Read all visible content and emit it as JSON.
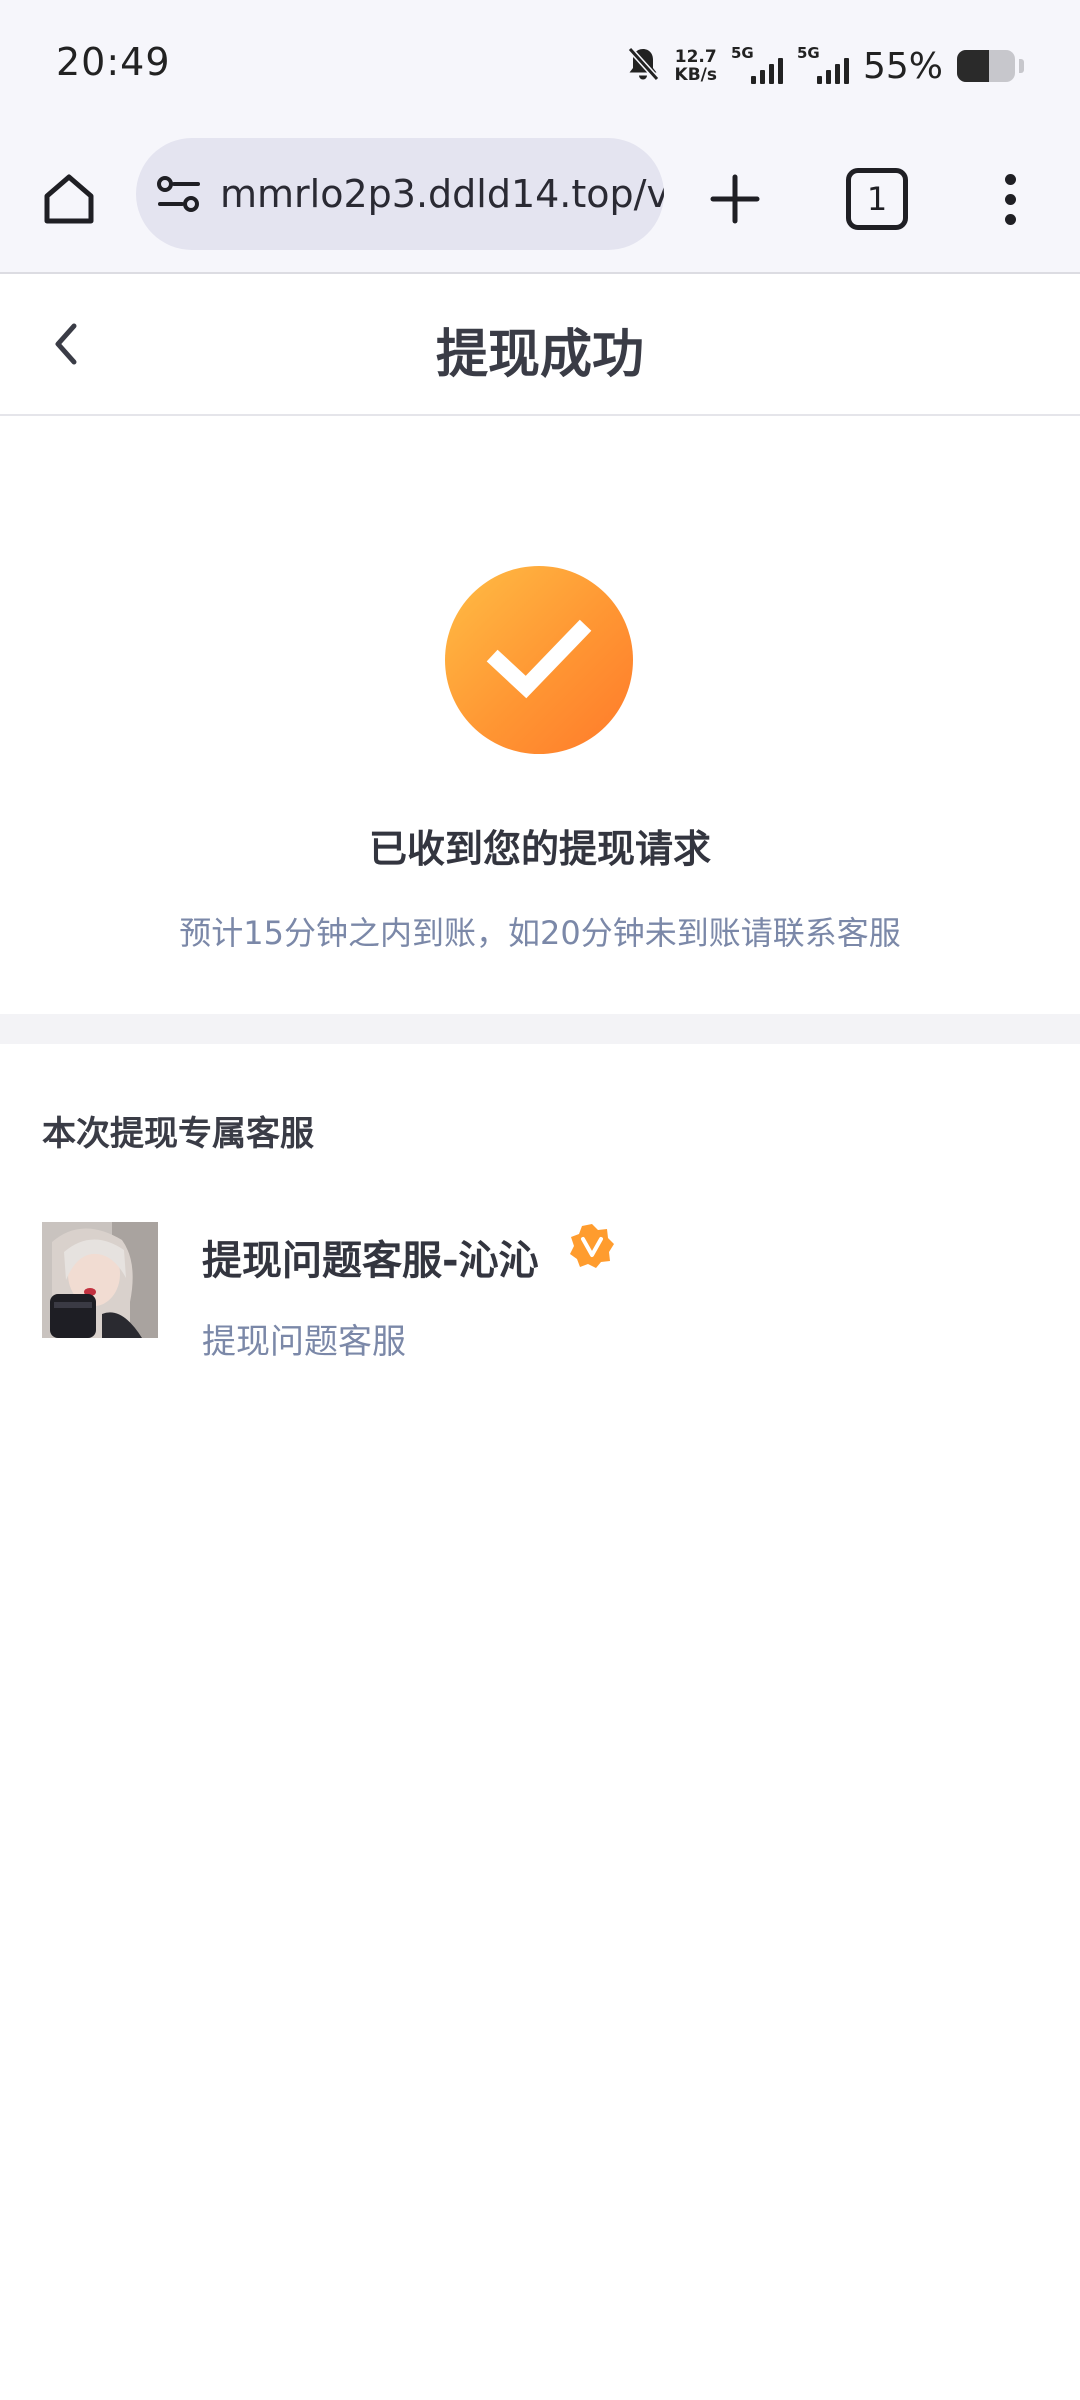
{
  "status_bar": {
    "time": "20:49",
    "net_speed_value": "12.7",
    "net_speed_unit": "KB/s",
    "sim1_tag": "5G",
    "sim2_tag": "5G",
    "battery_percent": "55%",
    "icons": [
      "bell-muted-icon",
      "signal-icon",
      "battery-icon"
    ]
  },
  "browser": {
    "url": "mmrlo2p3.ddld14.top/v",
    "tab_count": "1",
    "icons": [
      "home-icon",
      "site-settings-icon",
      "new-tab-icon",
      "tab-switcher-icon",
      "more-menu-icon"
    ]
  },
  "header": {
    "title": "提现成功",
    "icons": [
      "back-chevron-icon"
    ]
  },
  "result": {
    "title": "已收到您的提现请求",
    "subtitle": "预计15分钟之内到账，如20分钟未到账请联系客服",
    "icons": [
      "success-check-icon"
    ],
    "accent_color": "#ff9633"
  },
  "service": {
    "section_title": "本次提现专属客服",
    "agent_name": "提现问题客服-沁沁",
    "agent_role": "提现问题客服",
    "icons": [
      "verified-badge-icon",
      "avatar"
    ]
  }
}
